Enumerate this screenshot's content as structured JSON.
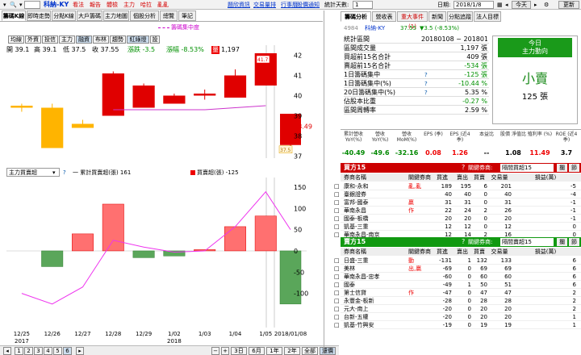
{
  "topbar": {
    "stock_code": "",
    "stock_name": "科納-KY",
    "links_red": [
      "看法",
      "報告",
      "體檢",
      "主力",
      "哈拉",
      "亂亂"
    ],
    "links_right": [
      "題欣資訊",
      "交易量排",
      "行事曆",
      "股價通知"
    ],
    "days_label": "統計天數:",
    "days_value": "1",
    "date_label": "日期:",
    "date_value": "2018/1/8",
    "today_btn": "今天",
    "refresh_btn": "更新"
  },
  "left_tabs": [
    "籌碼K線",
    "即時走勢",
    "分點K線",
    "大戶籌碼",
    "主力地圖",
    "個股分析",
    "總覽",
    "筆記"
  ],
  "chart_toolbar": {
    "chips": [
      "均線",
      "外資",
      "投信",
      "主力",
      "融資",
      "布林",
      "趨勢",
      "紅綠燈",
      "設"
    ],
    "legend_dashed": "籌碼集中度"
  },
  "price_info": {
    "open": "開 39.1",
    "high": "高 39.1",
    "low": "低 37.5",
    "close": "收 37.55",
    "change": "漲跌 -3.5",
    "pct": "漲幅 -8.53%",
    "vol_icon": "量",
    "volume": "1,197"
  },
  "lower_chart": {
    "selector": "主力買賣超",
    "legend_cum": "一 累計買賣超(張) 161",
    "legend_bar": "買賣超(張) -125"
  },
  "bottom_bar": {
    "pages": [
      "1",
      "2",
      "3",
      "4",
      "5",
      "6"
    ],
    "active_page": "6",
    "ranges": [
      "3日",
      "6月",
      "1年",
      "2年",
      "全部",
      "還價"
    ]
  },
  "chart_data": [
    {
      "type": "candlestick",
      "categories": [
        "12/25",
        "12/26",
        "12/27",
        "12/28",
        "12/29",
        "1/02",
        "1/03",
        "1/04",
        "1/05",
        "2018/01/08"
      ],
      "year_labels": [
        {
          "at": "12/25",
          "text": "2017"
        },
        {
          "at": "1/02",
          "text": "2018"
        }
      ],
      "open": [
        39.4,
        39.4,
        38.6,
        41.1,
        40.5,
        40.0,
        40.0,
        41.0,
        40.5,
        39.1
      ],
      "high": [
        39.6,
        39.6,
        38.8,
        41.2,
        40.6,
        40.1,
        40.3,
        41.3,
        42.1,
        39.1
      ],
      "low": [
        39.2,
        37.4,
        38.4,
        39.0,
        39.4,
        39.6,
        39.8,
        39.9,
        40.5,
        37.5
      ],
      "close": [
        39.5,
        37.4,
        38.4,
        39.0,
        39.4,
        39.6,
        40.1,
        39.9,
        42.1,
        37.55
      ],
      "colors": [
        "orange",
        "orange",
        "orange",
        "red",
        "red",
        "red",
        "red",
        "red",
        "red",
        "red"
      ],
      "y_ticks": [
        37,
        38,
        39,
        40,
        41,
        42
      ],
      "ylim": [
        36.9,
        42.5
      ],
      "last_price": "38.49",
      "high_label": "41.7",
      "low_label": "37.5",
      "concentration_line": [
        null,
        null,
        null,
        39.3,
        39.3,
        39.3,
        39.3,
        39.4,
        39.5,
        null
      ]
    },
    {
      "type": "bar",
      "categories": [
        "12/25",
        "12/26",
        "12/27",
        "12/28",
        "12/29",
        "1/02",
        "1/03",
        "1/04",
        "1/05",
        "2018/01/08"
      ],
      "values": [
        0,
        -37,
        40,
        110,
        -16,
        -12,
        3,
        57,
        82,
        -125
      ],
      "cumulative": [
        -100,
        -125,
        -85,
        25,
        9,
        -3,
        0,
        57,
        139,
        50
      ],
      "y_ticks": [
        150,
        100,
        50,
        0,
        -50,
        -100
      ],
      "ylim": [
        -150,
        165
      ]
    }
  ],
  "right_tabs": [
    "籌碼分析",
    "營收表",
    "重大事件(1)",
    "新聞",
    "分點追蹤",
    "法人目標"
  ],
  "stats": {
    "code": "4984",
    "name": "科納-KY",
    "price": "37.55",
    "change": "▼3.5 (-8.53%)",
    "rows": [
      {
        "label": "統計區間",
        "value": "20180108 ~ 20180108"
      },
      {
        "label": "區間成交量",
        "value": "1,197 張"
      },
      {
        "label": "買超前15名合計",
        "value": "409 張"
      },
      {
        "label": "賣超前15名合計",
        "value": "-534 張"
      },
      {
        "label": "1日籌碼集中",
        "value": "-125 張"
      },
      {
        "label": "1日籌碼集中(%)",
        "value": "-10.44 %"
      },
      {
        "label": "20日籌碼集中(%)",
        "value": "5.35 %"
      },
      {
        "label": "佔股本比重",
        "value": "-0.27 %"
      },
      {
        "label": "區間周轉率",
        "value": "2.59 %"
      }
    ],
    "today_title": "今日",
    "today_sub": "主力動向",
    "today_main": "小賣",
    "today_amount": "125 張"
  },
  "metrics": {
    "headers": [
      "累計營收 YoY(%)",
      "營收 YoY(%)",
      "營收 MoM(%)",
      "EPS (季)",
      "EPS (近4季)",
      "本益比",
      "股價 淨值比",
      "殖利率 (%)",
      "ROE (近4季)"
    ],
    "values": [
      "-40.49",
      "-49.6",
      "-32.16",
      "0.08",
      "1.26",
      "--",
      "1.08",
      "11.49",
      "3.7"
    ]
  },
  "buy_section": {
    "title": "買方15",
    "selector_label": "關鍵券商:",
    "selector_value": "隔間買超15",
    "btn1": "攔",
    "btn2": "節",
    "headers": [
      "券商名稱",
      "關鍵券商",
      "買進",
      "賣出",
      "買賣",
      "交易量",
      "損益(萬)"
    ],
    "rows": [
      [
        "康和-永和",
        "亂,亂",
        "189",
        "195",
        "6",
        "201",
        "-5"
      ],
      [
        "臺銀證券",
        "",
        "40",
        "40",
        "0",
        "40",
        "-4"
      ],
      [
        "富邦-國泰",
        "贏",
        "31",
        "31",
        "0",
        "31",
        "-1"
      ],
      [
        "華南永昌",
        "作",
        "22",
        "24",
        "2",
        "26",
        "-1"
      ],
      [
        "國泰-板橋",
        "",
        "20",
        "20",
        "0",
        "20",
        "-1"
      ],
      [
        "凱基-三重",
        "",
        "12",
        "12",
        "0",
        "12",
        "0"
      ],
      [
        "華南永昌-南京",
        "",
        "12",
        "14",
        "2",
        "16",
        "0"
      ],
      [
        "中國信託-中壢",
        "",
        "12",
        "12",
        "0",
        "12",
        "0"
      ],
      [
        "新光",
        "亂,作,動",
        "12",
        "24",
        "12",
        "36",
        "-2"
      ]
    ]
  },
  "sell_section": {
    "title": "賣方15",
    "selector_label": "關鍵券商:",
    "selector_value": "隔間賣超15",
    "btn1": "攔",
    "btn2": "節",
    "headers": [
      "券商名稱",
      "關鍵券商",
      "買進",
      "賣出",
      "買賣",
      "交易量",
      "損益(萬)"
    ],
    "rows": [
      [
        "日盛-三重",
        "動",
        "-131",
        "1",
        "132",
        "133",
        "6"
      ],
      [
        "美林",
        "出,贏",
        "-69",
        "0",
        "69",
        "69",
        "6"
      ],
      [
        "華南永昌-忠孝",
        "",
        "-60",
        "0",
        "60",
        "60",
        "6"
      ],
      [
        "國泰",
        "",
        "-49",
        "1",
        "50",
        "51",
        "6"
      ],
      [
        "第士信貸",
        "作",
        "-47",
        "0",
        "47",
        "47",
        "2"
      ],
      [
        "永豐金-板新",
        "",
        "-28",
        "0",
        "28",
        "28",
        "2"
      ],
      [
        "元大-南上",
        "",
        "-20",
        "0",
        "20",
        "20",
        "2"
      ],
      [
        "台新-五權",
        "",
        "-20",
        "0",
        "20",
        "20",
        "1"
      ],
      [
        "凱基-竹興安",
        "",
        "-19",
        "0",
        "19",
        "19",
        "1"
      ]
    ]
  }
}
